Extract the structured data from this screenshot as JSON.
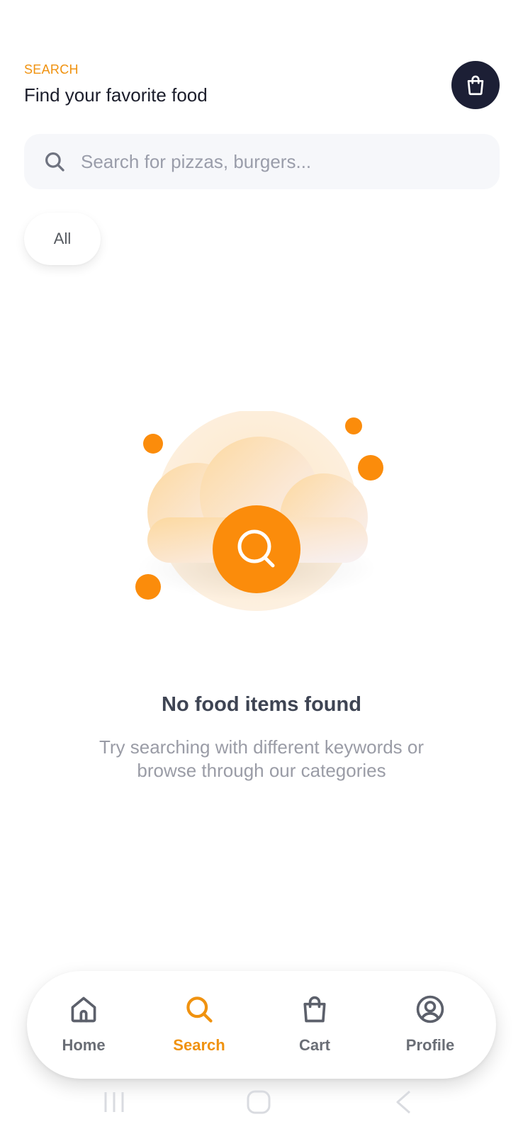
{
  "header": {
    "eyebrow": "SEARCH",
    "title": "Find your favorite food"
  },
  "search": {
    "placeholder": "Search for pizzas, burgers...",
    "value": ""
  },
  "filters": {
    "chips": [
      {
        "label": "All",
        "selected": true
      }
    ]
  },
  "empty_state": {
    "title": "No food items found",
    "description": "Try searching with different keywords or browse through our categories"
  },
  "bottom_nav": {
    "items": [
      {
        "label": "Home",
        "icon": "home-icon",
        "active": false
      },
      {
        "label": "Search",
        "icon": "search-icon",
        "active": true
      },
      {
        "label": "Cart",
        "icon": "shopping-bag-icon",
        "active": false
      },
      {
        "label": "Profile",
        "icon": "profile-icon",
        "active": false
      }
    ]
  },
  "colors": {
    "accent": "#f0920f",
    "dark": "#1c1f35",
    "text_muted": "#9a9ca6",
    "nav_inactive": "#6a6e76"
  }
}
